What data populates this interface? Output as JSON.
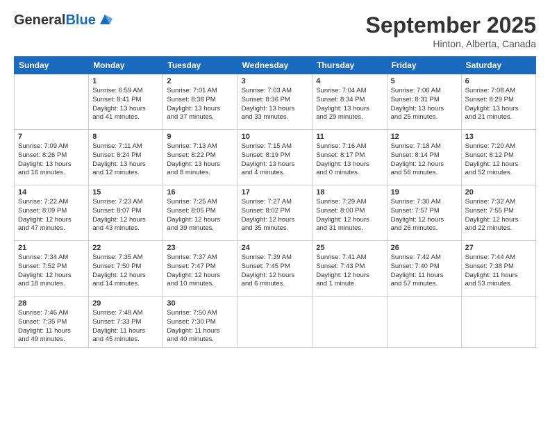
{
  "header": {
    "logo_general": "General",
    "logo_blue": "Blue",
    "month": "September 2025",
    "location": "Hinton, Alberta, Canada"
  },
  "weekdays": [
    "Sunday",
    "Monday",
    "Tuesday",
    "Wednesday",
    "Thursday",
    "Friday",
    "Saturday"
  ],
  "weeks": [
    [
      {
        "day": "",
        "info": ""
      },
      {
        "day": "1",
        "info": "Sunrise: 6:59 AM\nSunset: 8:41 PM\nDaylight: 13 hours\nand 41 minutes."
      },
      {
        "day": "2",
        "info": "Sunrise: 7:01 AM\nSunset: 8:38 PM\nDaylight: 13 hours\nand 37 minutes."
      },
      {
        "day": "3",
        "info": "Sunrise: 7:03 AM\nSunset: 8:36 PM\nDaylight: 13 hours\nand 33 minutes."
      },
      {
        "day": "4",
        "info": "Sunrise: 7:04 AM\nSunset: 8:34 PM\nDaylight: 13 hours\nand 29 minutes."
      },
      {
        "day": "5",
        "info": "Sunrise: 7:06 AM\nSunset: 8:31 PM\nDaylight: 13 hours\nand 25 minutes."
      },
      {
        "day": "6",
        "info": "Sunrise: 7:08 AM\nSunset: 8:29 PM\nDaylight: 13 hours\nand 21 minutes."
      }
    ],
    [
      {
        "day": "7",
        "info": "Sunrise: 7:09 AM\nSunset: 8:26 PM\nDaylight: 13 hours\nand 16 minutes."
      },
      {
        "day": "8",
        "info": "Sunrise: 7:11 AM\nSunset: 8:24 PM\nDaylight: 13 hours\nand 12 minutes."
      },
      {
        "day": "9",
        "info": "Sunrise: 7:13 AM\nSunset: 8:22 PM\nDaylight: 13 hours\nand 8 minutes."
      },
      {
        "day": "10",
        "info": "Sunrise: 7:15 AM\nSunset: 8:19 PM\nDaylight: 13 hours\nand 4 minutes."
      },
      {
        "day": "11",
        "info": "Sunrise: 7:16 AM\nSunset: 8:17 PM\nDaylight: 13 hours\nand 0 minutes."
      },
      {
        "day": "12",
        "info": "Sunrise: 7:18 AM\nSunset: 8:14 PM\nDaylight: 12 hours\nand 56 minutes."
      },
      {
        "day": "13",
        "info": "Sunrise: 7:20 AM\nSunset: 8:12 PM\nDaylight: 12 hours\nand 52 minutes."
      }
    ],
    [
      {
        "day": "14",
        "info": "Sunrise: 7:22 AM\nSunset: 8:09 PM\nDaylight: 12 hours\nand 47 minutes."
      },
      {
        "day": "15",
        "info": "Sunrise: 7:23 AM\nSunset: 8:07 PM\nDaylight: 12 hours\nand 43 minutes."
      },
      {
        "day": "16",
        "info": "Sunrise: 7:25 AM\nSunset: 8:05 PM\nDaylight: 12 hours\nand 39 minutes."
      },
      {
        "day": "17",
        "info": "Sunrise: 7:27 AM\nSunset: 8:02 PM\nDaylight: 12 hours\nand 35 minutes."
      },
      {
        "day": "18",
        "info": "Sunrise: 7:29 AM\nSunset: 8:00 PM\nDaylight: 12 hours\nand 31 minutes."
      },
      {
        "day": "19",
        "info": "Sunrise: 7:30 AM\nSunset: 7:57 PM\nDaylight: 12 hours\nand 26 minutes."
      },
      {
        "day": "20",
        "info": "Sunrise: 7:32 AM\nSunset: 7:55 PM\nDaylight: 12 hours\nand 22 minutes."
      }
    ],
    [
      {
        "day": "21",
        "info": "Sunrise: 7:34 AM\nSunset: 7:52 PM\nDaylight: 12 hours\nand 18 minutes."
      },
      {
        "day": "22",
        "info": "Sunrise: 7:35 AM\nSunset: 7:50 PM\nDaylight: 12 hours\nand 14 minutes."
      },
      {
        "day": "23",
        "info": "Sunrise: 7:37 AM\nSunset: 7:47 PM\nDaylight: 12 hours\nand 10 minutes."
      },
      {
        "day": "24",
        "info": "Sunrise: 7:39 AM\nSunset: 7:45 PM\nDaylight: 12 hours\nand 6 minutes."
      },
      {
        "day": "25",
        "info": "Sunrise: 7:41 AM\nSunset: 7:43 PM\nDaylight: 12 hours\nand 1 minute."
      },
      {
        "day": "26",
        "info": "Sunrise: 7:42 AM\nSunset: 7:40 PM\nDaylight: 11 hours\nand 57 minutes."
      },
      {
        "day": "27",
        "info": "Sunrise: 7:44 AM\nSunset: 7:38 PM\nDaylight: 11 hours\nand 53 minutes."
      }
    ],
    [
      {
        "day": "28",
        "info": "Sunrise: 7:46 AM\nSunset: 7:35 PM\nDaylight: 11 hours\nand 49 minutes."
      },
      {
        "day": "29",
        "info": "Sunrise: 7:48 AM\nSunset: 7:33 PM\nDaylight: 11 hours\nand 45 minutes."
      },
      {
        "day": "30",
        "info": "Sunrise: 7:50 AM\nSunset: 7:30 PM\nDaylight: 11 hours\nand 40 minutes."
      },
      {
        "day": "",
        "info": ""
      },
      {
        "day": "",
        "info": ""
      },
      {
        "day": "",
        "info": ""
      },
      {
        "day": "",
        "info": ""
      }
    ]
  ]
}
